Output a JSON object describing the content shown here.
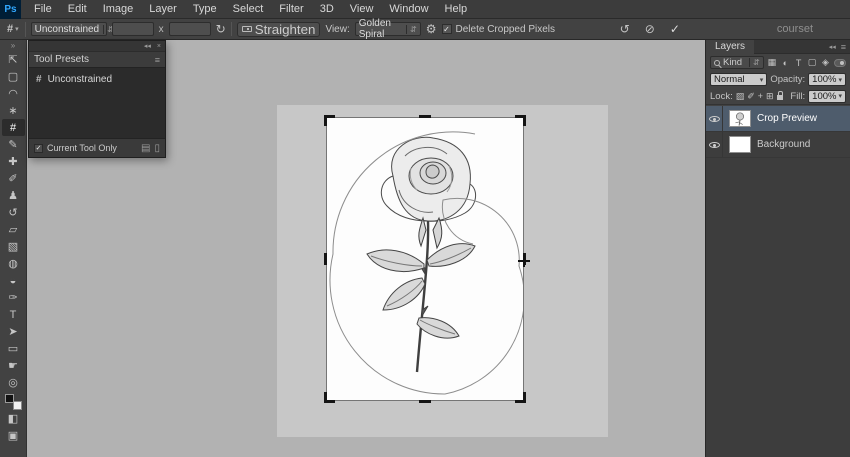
{
  "menubar": {
    "logo": "Ps",
    "items": [
      "File",
      "Edit",
      "Image",
      "Layer",
      "Type",
      "Select",
      "Filter",
      "3D",
      "View",
      "Window",
      "Help"
    ]
  },
  "options_bar": {
    "tool_glyph": "#",
    "preset_value": "Unconstrained",
    "width_value": "",
    "height_value": "",
    "dims_separator": "x",
    "rotate_glyph": "↻",
    "straighten_label": "Straighten",
    "view_label": "View:",
    "view_value": "Golden Spiral",
    "gear_glyph": "⚙",
    "delete_cropped_label": "Delete Cropped Pixels",
    "reset_glyph": "↺",
    "cancel_glyph": "⊘",
    "commit_glyph": "✓",
    "watermark": "courset"
  },
  "toolbar": {
    "quick_mask_glyph": "◧",
    "screen_mode_glyph": "▣",
    "tools": [
      {
        "name": "move",
        "glyph": "⇱"
      },
      {
        "name": "rectangular-marquee",
        "glyph": "▢"
      },
      {
        "name": "lasso",
        "glyph": "◠"
      },
      {
        "name": "quick-selection",
        "glyph": "∗"
      },
      {
        "name": "crop",
        "glyph": "#"
      },
      {
        "name": "eyedropper",
        "glyph": "✎"
      },
      {
        "name": "spot-healing-brush",
        "glyph": "✚"
      },
      {
        "name": "brush",
        "glyph": "✐"
      },
      {
        "name": "clone-stamp",
        "glyph": "♟"
      },
      {
        "name": "history-brush",
        "glyph": "↺"
      },
      {
        "name": "eraser",
        "glyph": "▱"
      },
      {
        "name": "gradient",
        "glyph": "▧"
      },
      {
        "name": "blur",
        "glyph": "◍"
      },
      {
        "name": "dodge",
        "glyph": "◒"
      },
      {
        "name": "pen",
        "glyph": "✑"
      },
      {
        "name": "type",
        "glyph": "T"
      },
      {
        "name": "path-selection",
        "glyph": "➤"
      },
      {
        "name": "rectangle-shape",
        "glyph": "▭"
      },
      {
        "name": "hand",
        "glyph": "☛"
      },
      {
        "name": "zoom",
        "glyph": "◎"
      }
    ]
  },
  "tool_presets": {
    "title": "Tool Presets",
    "item_glyph": "#",
    "item_label": "Unconstrained",
    "footer_label": "Current Tool Only",
    "new_preset_glyph": "▤",
    "delete_glyph": "▯"
  },
  "layers_panel": {
    "title": "Layers",
    "kind_label": "Kind",
    "filter_icons": [
      "▦",
      "◐",
      "T",
      "▢",
      "◈"
    ],
    "blend_mode": "Normal",
    "opacity_label": "Opacity:",
    "opacity_value": "100%",
    "lock_label": "Lock:",
    "lock_icons": [
      "▨",
      "✐",
      "+",
      "⊞"
    ],
    "fill_label": "Fill:",
    "fill_value": "100%",
    "layers": [
      {
        "name": "Crop Preview"
      },
      {
        "name": "Background"
      }
    ]
  },
  "ui_glyphs": {
    "combo_arrows": "⇵",
    "dropdown_arrow": "▾",
    "collapse_left": "◂◂",
    "collapse_right": "»",
    "menu": "≡",
    "close": "×",
    "check": "✓"
  }
}
